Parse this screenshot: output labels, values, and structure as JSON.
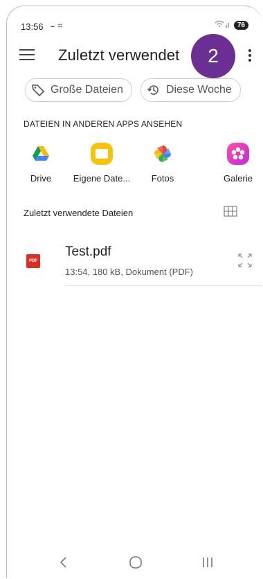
{
  "status_bar": {
    "time": "13:56",
    "left_icons": "⌣ ⌗",
    "battery": "76"
  },
  "app_bar": {
    "title": "Zuletzt verwendet",
    "step_badge": "2"
  },
  "chips": [
    {
      "label": "Große Dateien",
      "icon": "tag-icon"
    },
    {
      "label": "Diese Woche",
      "icon": "history-icon"
    }
  ],
  "apps_section": {
    "header": "DATEIEN IN ANDEREN APPS ANSEHEN",
    "apps": [
      {
        "label": "Drive",
        "icon": "google-drive-icon"
      },
      {
        "label": "Eigene Date...",
        "icon": "my-files-folder-icon"
      },
      {
        "label": "Fotos",
        "icon": "google-photos-icon"
      },
      {
        "label": "Galerie",
        "icon": "gallery-flower-icon"
      }
    ]
  },
  "recent_section": {
    "header": "Zuletzt verwendete Dateien",
    "files": [
      {
        "name": "Test.pdf",
        "meta": "13:54, 180 kB, Dokument (PDF)",
        "type_badge": "PDF"
      }
    ]
  },
  "colors": {
    "badge": "#6b2f94",
    "pdf": "#d93025"
  }
}
